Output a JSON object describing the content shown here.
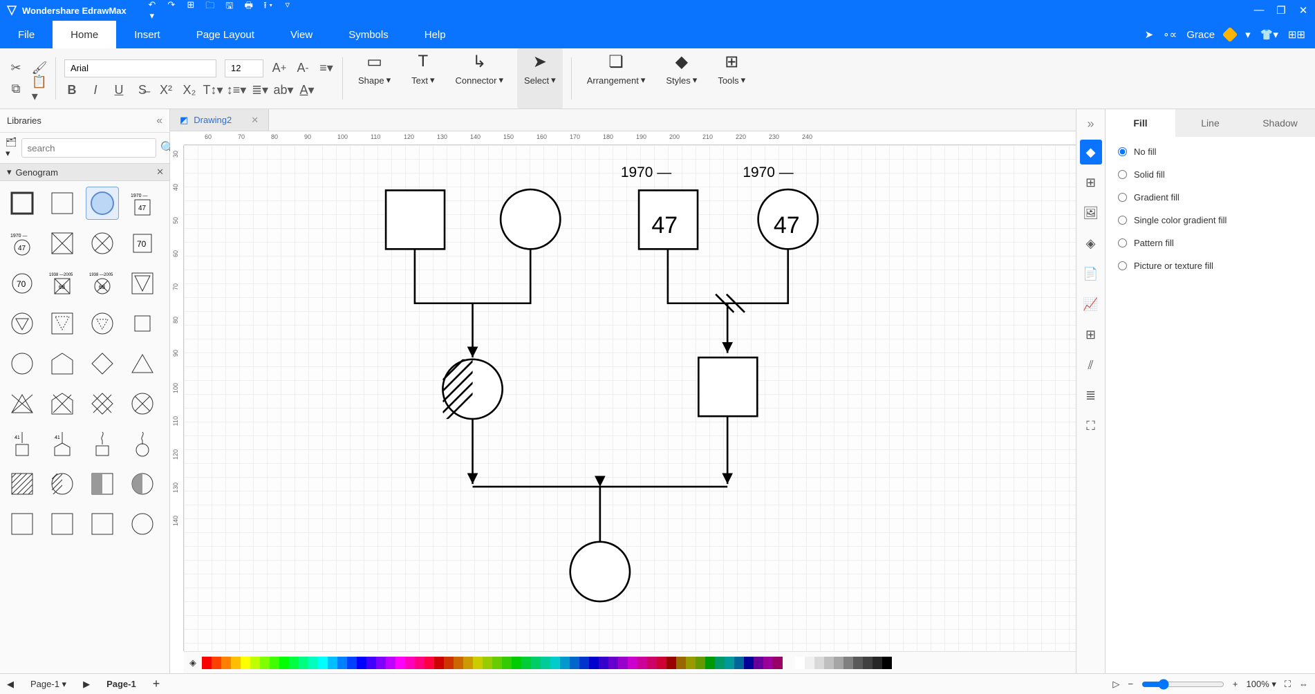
{
  "titlebar": {
    "app_name": "Wondershare EdrawMax"
  },
  "menus": {
    "file": "File",
    "home": "Home",
    "insert": "Insert",
    "page_layout": "Page Layout",
    "view": "View",
    "symbols": "Symbols",
    "help": "Help"
  },
  "user": {
    "name": "Grace"
  },
  "ribbon": {
    "font": "Arial",
    "size": "12",
    "shape": "Shape",
    "text": "Text",
    "connector": "Connector",
    "select": "Select",
    "arrangement": "Arrangement",
    "styles": "Styles",
    "tools": "Tools"
  },
  "doc_tab": {
    "name": "Drawing2"
  },
  "left": {
    "title": "Libraries",
    "search_placeholder": "search",
    "category": "Genogram"
  },
  "ruler_h": [
    "60",
    "70",
    "80",
    "90",
    "100",
    "110",
    "120",
    "130",
    "140",
    "150",
    "160",
    "170",
    "180",
    "190",
    "200",
    "210",
    "220",
    "230",
    "240"
  ],
  "ruler_v": [
    "30",
    "40",
    "50",
    "60",
    "70",
    "80",
    "90",
    "100",
    "110",
    "120",
    "130",
    "140"
  ],
  "canvas": {
    "year1": "1970 —",
    "year2": "1970 —",
    "age1": "47",
    "age2": "47"
  },
  "prop": {
    "tabs": {
      "fill": "Fill",
      "line": "Line",
      "shadow": "Shadow"
    },
    "opts": {
      "nofill": "No fill",
      "solid": "Solid fill",
      "gradient": "Gradient fill",
      "single": "Single color gradient fill",
      "pattern": "Pattern fill",
      "picture": "Picture or texture fill"
    }
  },
  "pages": {
    "dropdown": "Page-1",
    "active": "Page-1"
  },
  "zoom": {
    "pct": "100%"
  },
  "colors": [
    "#ff0000",
    "#ff4000",
    "#ff8000",
    "#ffbf00",
    "#ffff00",
    "#bfff00",
    "#80ff00",
    "#40ff00",
    "#00ff00",
    "#00ff40",
    "#00ff80",
    "#00ffbf",
    "#00ffff",
    "#00bfff",
    "#0080ff",
    "#0040ff",
    "#0000ff",
    "#4000ff",
    "#8000ff",
    "#bf00ff",
    "#ff00ff",
    "#ff00bf",
    "#ff0080",
    "#ff0040",
    "#cc0000",
    "#cc3300",
    "#cc6600",
    "#cc9900",
    "#cccc00",
    "#99cc00",
    "#66cc00",
    "#33cc00",
    "#00cc00",
    "#00cc33",
    "#00cc66",
    "#00cc99",
    "#00cccc",
    "#0099cc",
    "#0066cc",
    "#0033cc",
    "#0000cc",
    "#3300cc",
    "#6600cc",
    "#9900cc",
    "#cc00cc",
    "#cc0099",
    "#cc0066",
    "#cc0033",
    "#990000",
    "#996600",
    "#999900",
    "#669900",
    "#009900",
    "#009966",
    "#009999",
    "#006699",
    "#000099",
    "#660099",
    "#990099",
    "#990066"
  ],
  "grays": [
    "#ffffff",
    "#f0f0f0",
    "#d9d9d9",
    "#bfbfbf",
    "#a6a6a6",
    "#808080",
    "#595959",
    "#404040",
    "#262626",
    "#000000"
  ]
}
